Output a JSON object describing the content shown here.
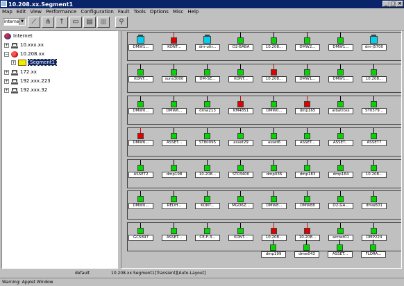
{
  "window": {
    "title": "10.208.xx.Segment1"
  },
  "menu": [
    "Map",
    "Edit",
    "View",
    "Performance",
    "Configuration",
    "Fault",
    "Tools",
    "Options",
    "Misc",
    "Help"
  ],
  "toolbar": {
    "view_select": "Internet"
  },
  "tree": {
    "root": "Internet",
    "nodes": [
      "10.xxx.xx",
      "10.208.xx",
      "Segment1",
      "172.xx",
      "192.xxx.223",
      "192.xxx.32"
    ]
  },
  "map": {
    "rows": [
      [
        {
          "label": "DMW1...",
          "state": "cyan"
        },
        {
          "label": "KONT...",
          "state": "red"
        },
        {
          "label": "dm-ultr...",
          "state": "cyan"
        },
        {
          "label": "O2-BABA",
          "state": "green"
        },
        {
          "label": "10.208...",
          "state": "green"
        },
        {
          "label": "DMW2...",
          "state": "green"
        },
        {
          "label": "DMW1...",
          "state": "green"
        },
        {
          "label": "dm-j5700",
          "state": "cyan"
        }
      ],
      [
        {
          "label": "KONT...",
          "state": "green"
        },
        {
          "label": "suns3000",
          "state": "green"
        },
        {
          "label": "DM-SE...",
          "state": "green"
        },
        {
          "label": "KONT...",
          "state": "green"
        },
        {
          "label": "10.208...",
          "state": "red"
        },
        {
          "label": "DMW1...",
          "state": "green"
        },
        {
          "label": "DMW1...",
          "state": "green"
        },
        {
          "label": "10.208...",
          "state": "green"
        }
      ],
      [
        {
          "label": "DMW0...",
          "state": "green"
        },
        {
          "label": "DMW6...",
          "state": "green"
        },
        {
          "label": "dmw213",
          "state": "green"
        },
        {
          "label": "KM4851",
          "state": "red"
        },
        {
          "label": "DMW0...",
          "state": "green"
        },
        {
          "label": "dmp165",
          "state": "red"
        },
        {
          "label": "albatross",
          "state": "green"
        },
        {
          "label": "ST0379...",
          "state": "green"
        }
      ],
      [
        {
          "label": "DMW6...",
          "state": "red"
        },
        {
          "label": "ASSET...",
          "state": "green"
        },
        {
          "label": "ST80095",
          "state": "green"
        },
        {
          "label": "asset29",
          "state": "green"
        },
        {
          "label": "asset6",
          "state": "green"
        },
        {
          "label": "ASSET...",
          "state": "green"
        },
        {
          "label": "ASSET...",
          "state": "green"
        },
        {
          "label": "ASSET7",
          "state": "green"
        }
      ],
      [
        {
          "label": "ASSET2",
          "state": "green"
        },
        {
          "label": "dmp198",
          "state": "green"
        },
        {
          "label": "10.208...",
          "state": "green"
        },
        {
          "label": "ST03400",
          "state": "green"
        },
        {
          "label": "dmp036",
          "state": "green"
        },
        {
          "label": "dmp183",
          "state": "green"
        },
        {
          "label": "dmp164",
          "state": "green"
        },
        {
          "label": "10.208...",
          "state": "green"
        }
      ],
      [
        {
          "label": "DMW0...",
          "state": "green"
        },
        {
          "label": "REDH...",
          "state": "green"
        },
        {
          "label": "KONT...",
          "state": "green"
        },
        {
          "label": "MGD6Z...",
          "state": "green"
        },
        {
          "label": "DMW8...",
          "state": "green"
        },
        {
          "label": "DMW88",
          "state": "green"
        },
        {
          "label": "O2-GA...",
          "state": "green"
        },
        {
          "label": "dmw601",
          "state": "green"
        }
      ],
      [
        {
          "label": "GC5897",
          "state": "green"
        },
        {
          "label": "ASSET...",
          "state": "green"
        },
        {
          "label": "CE-F-3...",
          "state": "green"
        },
        {
          "label": "KONT...",
          "state": "green"
        },
        {
          "label": "10.208...",
          "state": "red"
        },
        {
          "label": "10.208...",
          "state": "red"
        },
        {
          "label": "acrost01",
          "state": "green"
        },
        {
          "label": "DMP224",
          "state": "green"
        }
      ],
      [
        {
          "label": "dmp199",
          "state": "green"
        },
        {
          "label": "dmw043",
          "state": "green"
        },
        {
          "label": "ASSET...",
          "state": "green"
        },
        {
          "label": "FLORA...",
          "state": "green"
        }
      ]
    ]
  },
  "status": {
    "left": "default",
    "center": "10.208.xx.Segment1",
    "right": "[Transient][Auto-Layout]"
  },
  "warning": "Warning: Applet Window"
}
